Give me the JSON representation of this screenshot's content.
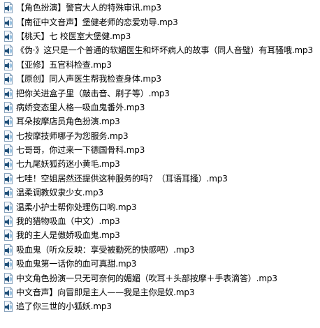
{
  "file_icon": "mp3-audio-file-icon",
  "colors": {
    "icon_speaker_dark": "#1f4f78",
    "icon_speaker_light": "#7fb3d9",
    "icon_page": "#f4f7fb",
    "icon_border": "#8aa4bd"
  },
  "files": [
    {
      "name": "【角色扮演】警官大人的特殊审讯.mp3"
    },
    {
      "name": "【南征中文音声】堡健老师的恋爱劝导.mp3"
    },
    {
      "name": "【桃夭】七 校医室大堡健.mp3"
    },
    {
      "name": "《伪·》这只是一个普通的软媚医生和坏坏病人的故事（同人音璧）有耳骚哦.mp3"
    },
    {
      "name": "【亚修】五官科检查.mp3"
    },
    {
      "name": "【原创】同人声医生帮我检查身体.mp3"
    },
    {
      "name": "把你关进盒子里（敲击音、刷子等）.mp3"
    },
    {
      "name": "病娇变态里人格—吸血鬼番外.mp3"
    },
    {
      "name": "耳朵按摩店员角色扮演.mp3"
    },
    {
      "name": "七按摩技师哪子为您服务.mp3"
    },
    {
      "name": "七哥哥，你过来一下德国骨科.mp3"
    },
    {
      "name": "七九尾妖狐药迷小黄毛.mp3"
    },
    {
      "name": "七哇！空姐居然还提供这种服务的吗？（耳语耳搔）.mp3"
    },
    {
      "name": "温柔调教奴隶少女.mp3"
    },
    {
      "name": "温柔小护士帮你处理伤口哟.mp3"
    },
    {
      "name": "我的猎物吸血（中文）.mp3"
    },
    {
      "name": "我的主人是傲娇吸血鬼.mp3"
    },
    {
      "name": "吸血鬼（听众反映：享受被勤死的快感吧）.mp3"
    },
    {
      "name": "吸血鬼第一话你的血可真甜.mp3"
    },
    {
      "name": "中文角色扮演一只无可奈何的媚媚（吹耳＋头部按摩＋手表滴答）.mp3"
    },
    {
      "name": "中文音声】向冒即是主人——我是主你是奴.mp3"
    },
    {
      "name": "追了你三世的小狐妖.mp3"
    }
  ]
}
